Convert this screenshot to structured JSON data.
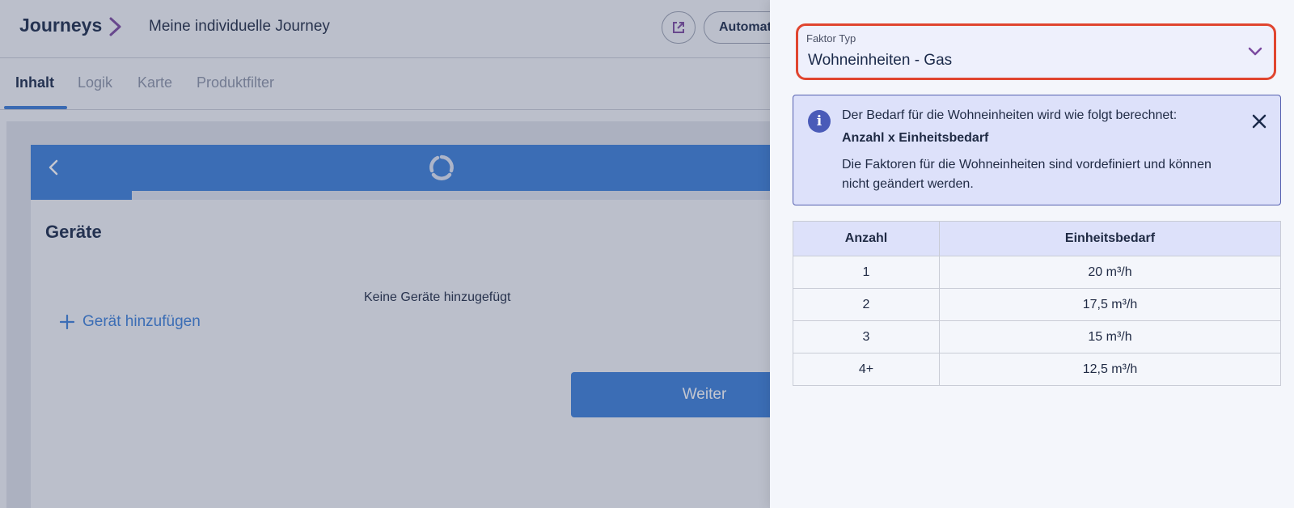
{
  "header": {
    "brand": "Journeys",
    "journey_name": "Meine individuelle Journey",
    "automation_label": "Automat"
  },
  "tabs": [
    {
      "label": "Inhalt",
      "active": true
    },
    {
      "label": "Logik",
      "active": false
    },
    {
      "label": "Karte",
      "active": false
    },
    {
      "label": "Produktfilter",
      "active": false
    }
  ],
  "preview": {
    "progress_fraction": 0.08,
    "section_title": "Geräte",
    "empty_text": "Keine Geräte hinzugefügt",
    "add_device_label": "Gerät hinzufügen",
    "next_label": "Weiter"
  },
  "drawer": {
    "select": {
      "label": "Faktor Typ",
      "value": "Wohneinheiten - Gas"
    },
    "info": {
      "line1": "Der Bedarf für die Wohneinheiten wird wie folgt berechnet:",
      "formula": "Anzahl x Einheitsbedarf",
      "note": "Die Faktoren für die Wohneinheiten sind vordefiniert und können nicht geändert werden."
    },
    "table": {
      "headers": [
        "Anzahl",
        "Einheitsbedarf"
      ],
      "rows": [
        [
          "1",
          "20 m³/h"
        ],
        [
          "2",
          "17,5 m³/h"
        ],
        [
          "3",
          "15 m³/h"
        ],
        [
          "4+",
          "12,5 m³/h"
        ]
      ]
    }
  },
  "colors": {
    "accent": "#3b7ed8",
    "highlight_border": "#e0452f",
    "info_bg": "#dde1fa",
    "info_icon": "#4a5bb8"
  },
  "icons": {
    "breadcrumb_separator": "chevron-right-icon",
    "external": "external-link-icon",
    "back": "chevron-left-icon",
    "logo": "logo-icon",
    "add": "plus-icon",
    "select_toggle": "chevron-down-icon",
    "info": "info-icon",
    "close": "close-icon"
  }
}
